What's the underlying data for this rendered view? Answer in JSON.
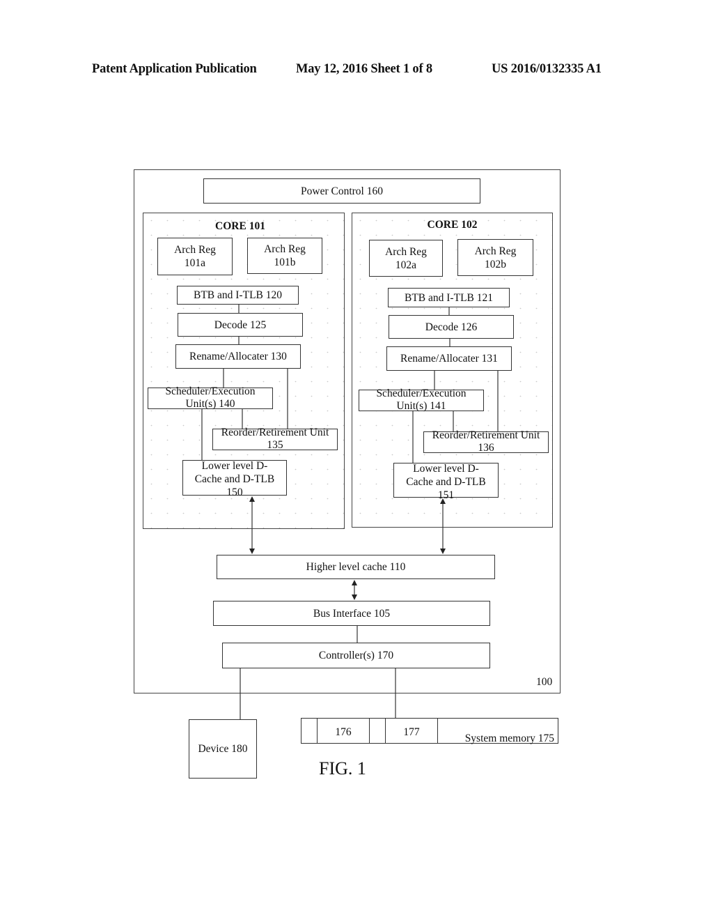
{
  "header": {
    "publication": "Patent Application Publication",
    "date_sheet": "May 12, 2016   Sheet 1 of 8",
    "number": "US 2016/0132335 A1"
  },
  "diagram": {
    "outer_label": "100",
    "power_control": "Power Control 160",
    "core1": {
      "title": "CORE 101",
      "arch_reg_a": "Arch Reg 101a",
      "arch_reg_b": "Arch Reg 101b",
      "btb": "BTB and I-TLB 120",
      "decode": "Decode 125",
      "rename": "Rename/Allocater 130",
      "scheduler": "Scheduler/Execution Unit(s) 140",
      "reorder": "Reorder/Retirement Unit 135",
      "dcache": "Lower level D-Cache and D-TLB 150"
    },
    "core2": {
      "title": "CORE 102",
      "arch_reg_a": "Arch Reg 102a",
      "arch_reg_b": "Arch Reg 102b",
      "btb": "BTB and I-TLB 121",
      "decode": "Decode 126",
      "rename": "Rename/Allocater 131",
      "scheduler": "Scheduler/Execution Unit(s) 141",
      "reorder": "Reorder/Retirement Unit 136",
      "dcache": "Lower level D-Cache and D-TLB 151"
    },
    "higher_cache": "Higher level cache 110",
    "bus_interface": "Bus Interface 105",
    "controllers": "Controller(s) 170",
    "device": "Device 180",
    "memory": {
      "seg1": "176",
      "seg2": "177",
      "label": "System memory 175"
    },
    "figure_caption": "FIG. 1"
  }
}
